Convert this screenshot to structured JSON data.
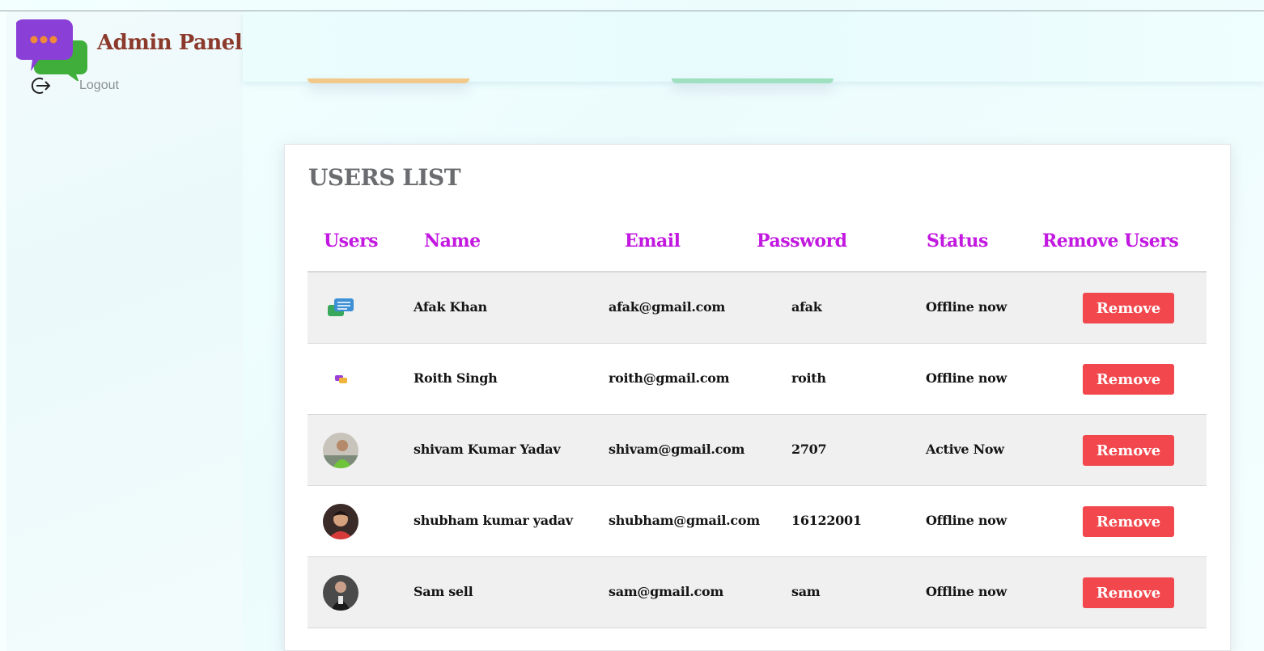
{
  "brand": {
    "title": "Admin Panel"
  },
  "sidebar": {
    "logout_label": "Logout"
  },
  "users_list": {
    "title": "USERS LIST",
    "columns": [
      "Users",
      "Name",
      "Email",
      "Password",
      "Status",
      "Remove Users"
    ],
    "rows": [
      {
        "avatar": "chat-bubbles-icon",
        "name": "Afak Khan",
        "email": "afak@gmail.com",
        "password": "afak",
        "status": "Offline now",
        "action": "Remove"
      },
      {
        "avatar": "small-chat-icon",
        "name": "Roith Singh",
        "email": "roith@gmail.com",
        "password": "roith",
        "status": "Offline now",
        "action": "Remove"
      },
      {
        "avatar": "user-photo",
        "name": "shivam Kumar Yadav",
        "email": "shivam@gmail.com",
        "password": "2707",
        "status": "Active Now",
        "action": "Remove"
      },
      {
        "avatar": "user-photo",
        "name": "shubham kumar yadav",
        "email": "shubham@gmail.com",
        "password": "16122001",
        "status": "Offline now",
        "action": "Remove"
      },
      {
        "avatar": "user-photo",
        "name": "Sam sell",
        "email": "sam@gmail.com",
        "password": "sam",
        "status": "Offline now",
        "action": "Remove"
      }
    ]
  },
  "colors": {
    "brand": "#8b3a2c",
    "header_text": "#c218e0",
    "remove_button": "#f1474d",
    "title": "#6a6c6f"
  }
}
